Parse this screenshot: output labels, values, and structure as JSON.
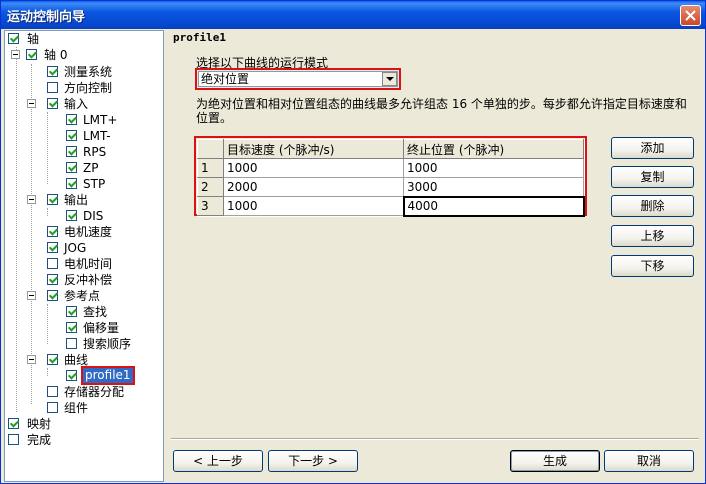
{
  "window": {
    "title": "运动控制向导"
  },
  "tree": {
    "items": [
      {
        "label": "轴",
        "checked": true
      },
      {
        "label": "轴 0",
        "checked": true
      },
      {
        "label": "测量系统",
        "checked": true
      },
      {
        "label": "方向控制",
        "checked": false
      },
      {
        "label": "输入",
        "checked": true
      },
      {
        "label": "LMT+",
        "checked": true
      },
      {
        "label": "LMT-",
        "checked": true
      },
      {
        "label": "RPS",
        "checked": true
      },
      {
        "label": "ZP",
        "checked": true
      },
      {
        "label": "STP",
        "checked": true
      },
      {
        "label": "输出",
        "checked": true
      },
      {
        "label": "DIS",
        "checked": true
      },
      {
        "label": "电机速度",
        "checked": true
      },
      {
        "label": "JOG",
        "checked": true
      },
      {
        "label": "电机时间",
        "checked": false
      },
      {
        "label": "反冲补偿",
        "checked": true
      },
      {
        "label": "参考点",
        "checked": true
      },
      {
        "label": "查找",
        "checked": true
      },
      {
        "label": "偏移量",
        "checked": true
      },
      {
        "label": "搜索顺序",
        "checked": false
      },
      {
        "label": "曲线",
        "checked": true
      },
      {
        "label": "profile1",
        "checked": true
      },
      {
        "label": "存储器分配",
        "checked": false
      },
      {
        "label": "组件",
        "checked": false
      },
      {
        "label": "映射",
        "checked": true
      },
      {
        "label": "完成",
        "checked": false
      }
    ]
  },
  "panel": {
    "heading": "profile1",
    "mode_label": "选择以下曲线的运行模式",
    "mode_value": "绝对位置",
    "description": "为绝对位置和相对位置组态的曲线最多允许组态 16 个单独的步。每步都允许指定目标速度和位置。"
  },
  "grid": {
    "headers": [
      "目标速度 (个脉冲/s)",
      "终止位置 (个脉冲)"
    ],
    "rows": [
      {
        "num": "1",
        "speed": "1000",
        "pos": "1000"
      },
      {
        "num": "2",
        "speed": "2000",
        "pos": "3000"
      },
      {
        "num": "3",
        "speed": "1000",
        "pos": "4000"
      }
    ]
  },
  "side_buttons": {
    "add": "添加",
    "copy": "复制",
    "delete": "删除",
    "up": "上移",
    "down": "下移"
  },
  "footer": {
    "prev": "< 上一步",
    "next": "下一步 >",
    "generate": "生成",
    "cancel": "取消"
  },
  "colors": {
    "accent": "#0a55e0",
    "highlight": "#dd1111",
    "selection": "#316ac5"
  }
}
